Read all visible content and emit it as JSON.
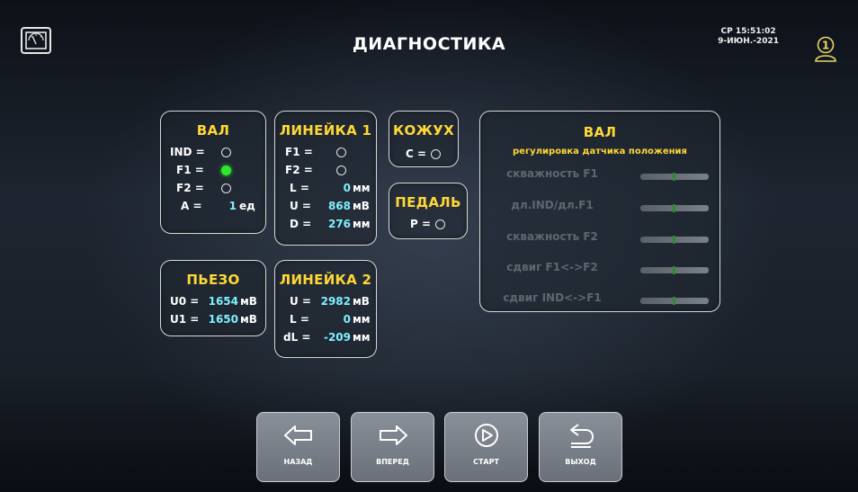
{
  "header": {
    "title": "ДИАГНОСТИКА",
    "datetime_line1": "СР 15:51:02",
    "datetime_line2": "9-ИЮН.-2021",
    "user_number": "1"
  },
  "val_panel": {
    "title": "ВАЛ",
    "ind_label": "IND =",
    "f1_label": "F1 =",
    "f2_label": "F2 =",
    "a_label": "A =",
    "a_value": "1",
    "a_unit": "ед",
    "ind_state": "off",
    "f1_state": "on",
    "f2_state": "off"
  },
  "lineika1_panel": {
    "title": "ЛИНЕЙКА 1",
    "f1_label": "F1 =",
    "f2_label": "F2 =",
    "l_label": "L =",
    "l_value": "0",
    "l_unit": "мм",
    "u_label": "U =",
    "u_value": "868",
    "u_unit": "мВ",
    "d_label": "D =",
    "d_value": "276",
    "d_unit": "мм"
  },
  "kozhukh_panel": {
    "title": "КОЖУХ",
    "c_label": "C ="
  },
  "pedal_panel": {
    "title": "ПЕДАЛЬ",
    "p_label": "P ="
  },
  "pyezo_panel": {
    "title": "ПЬЕЗО",
    "u0_label": "U0 =",
    "u0_value": "1654",
    "u0_unit": "мВ",
    "u1_label": "U1 =",
    "u1_value": "1650",
    "u1_unit": "мВ"
  },
  "lineika2_panel": {
    "title": "ЛИНЕЙКА 2",
    "u_label": "U =",
    "u_value": "2982",
    "u_unit": "мВ",
    "l_label": "L =",
    "l_value": "0",
    "l_unit": "мм",
    "dl_label": "dL =",
    "dl_value": "-209",
    "dl_unit": "мм"
  },
  "adjust_panel": {
    "title": "ВАЛ",
    "subtitle": "регулировка датчика положения",
    "rows": [
      {
        "label": "скважность F1"
      },
      {
        "label": "дл.IND/дл.F1"
      },
      {
        "label": "скважность F2"
      },
      {
        "label": "сдвиг F1<->F2"
      },
      {
        "label": "сдвиг IND<->F1"
      }
    ]
  },
  "buttons": {
    "back": "НАЗАД",
    "forward": "ВПЕРЕД",
    "start": "СТАРТ",
    "exit": "ВЫХОД"
  },
  "colors": {
    "title_yellow": "#ffd835",
    "value_cyan": "#7ff0ff",
    "indicator_on": "#2ee82a"
  }
}
